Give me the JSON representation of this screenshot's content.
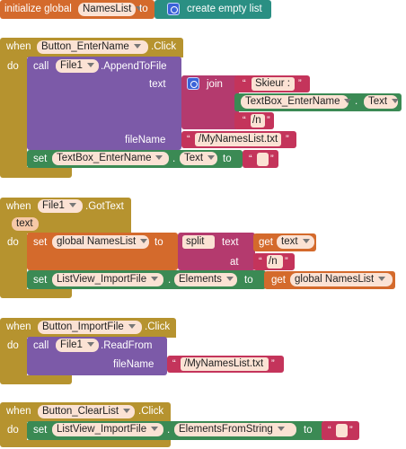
{
  "global_block": {
    "prefix": "initialize global",
    "var_name": "NamesList",
    "to": "to",
    "create_label": "create empty list"
  },
  "block1": {
    "when": "when",
    "component": "Button_EnterName",
    "event": ".Click",
    "do": "do",
    "call": "call",
    "file_component": "File1",
    "method": ".AppendToFile",
    "text_param": "text",
    "join": "join",
    "string1": "Skieur :",
    "textbox": "TextBox_EnterName",
    "text_prop": "Text",
    "string2": "/n",
    "filename_param": "fileName",
    "filename_value": "/MyNamesList.txt",
    "set": "set",
    "set_component": "TextBox_EnterName",
    "set_prop": "Text",
    "to": "to",
    "empty_string": ""
  },
  "block2": {
    "when": "when",
    "component": "File1",
    "event": ".GotText",
    "param": "text",
    "do": "do",
    "set": "set",
    "global_var": "global NamesList",
    "to": "to",
    "split": "split",
    "text_param": "text",
    "get": "get",
    "get_var": "text",
    "at": "at",
    "at_value": "/n",
    "set2": "set",
    "listview": "ListView_ImportFile",
    "elements": "Elements",
    "to2": "to",
    "get2": "get",
    "get_global": "global NamesList"
  },
  "block3": {
    "when": "when",
    "component": "Button_ImportFile",
    "event": ".Click",
    "do": "do",
    "call": "call",
    "file_component": "File1",
    "method": ".ReadFrom",
    "filename_param": "fileName",
    "filename_value": "/MyNamesList.txt"
  },
  "block4": {
    "when": "when",
    "component": "Button_ClearList",
    "event": ".Click",
    "do": "do",
    "set": "set",
    "listview": "ListView_ImportFile",
    "prop": "ElementsFromString",
    "to": "to",
    "empty_string": ""
  },
  "quotes": {
    "open": "“",
    "close": "”"
  }
}
